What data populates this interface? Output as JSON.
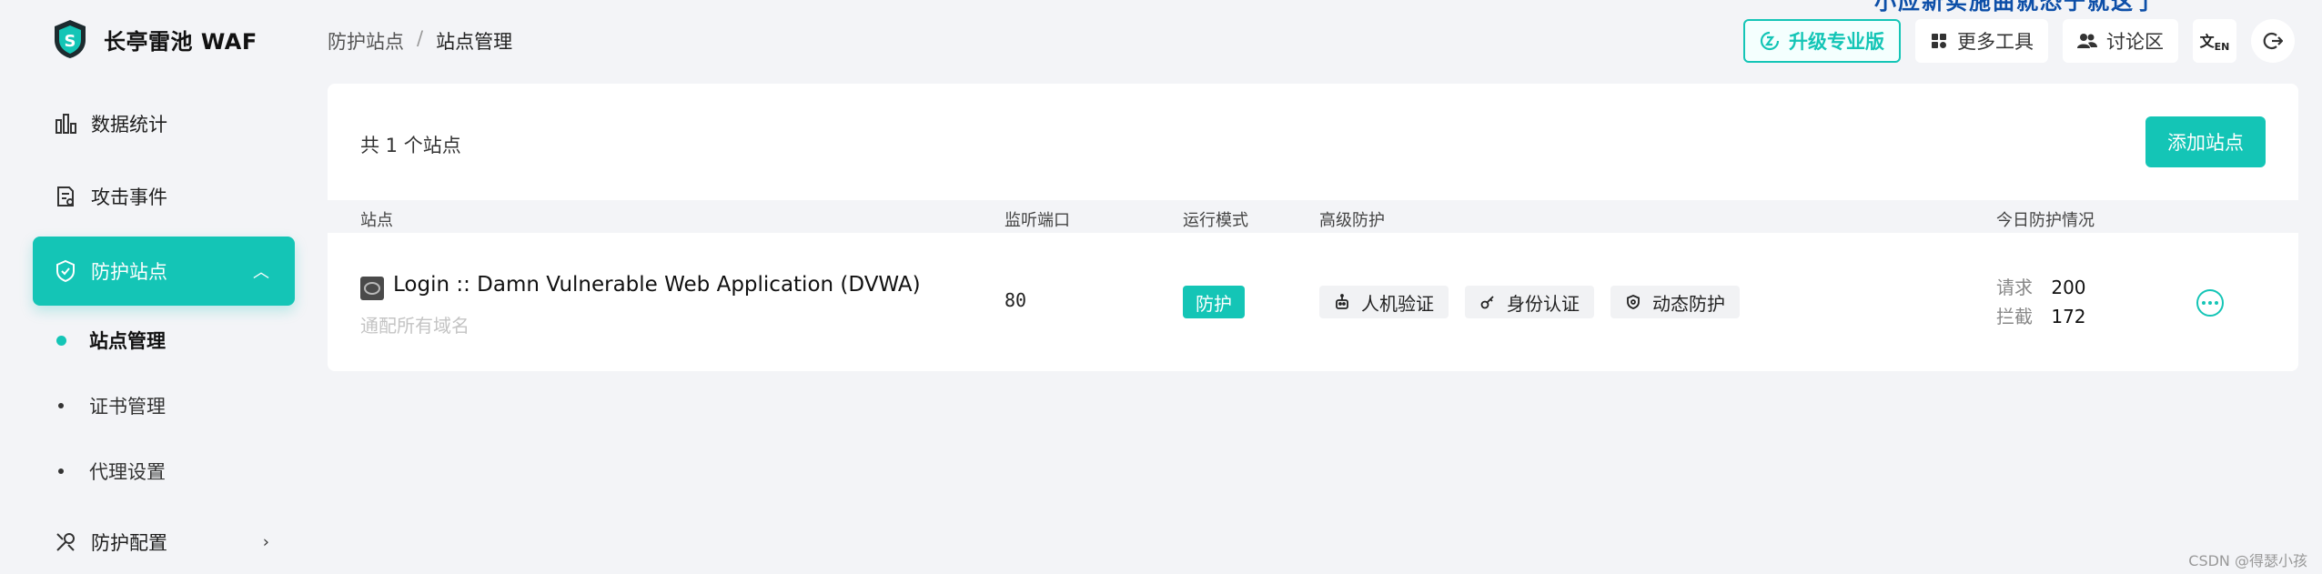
{
  "app": {
    "name": "长亭雷池 WAF"
  },
  "top_fragment": "小应新实施曲就恐于就这了",
  "sidebar": {
    "items": [
      {
        "label": "数据统计",
        "icon": "bar-chart-icon"
      },
      {
        "label": "攻击事件",
        "icon": "document-alert-icon"
      },
      {
        "label": "防护站点",
        "icon": "shield-icon",
        "active": true,
        "expanded": true
      },
      {
        "label": "防护配置",
        "icon": "tools-icon"
      }
    ],
    "sub_items": [
      {
        "label": "站点管理",
        "active": true
      },
      {
        "label": "证书管理"
      },
      {
        "label": "代理设置"
      }
    ]
  },
  "breadcrumb": {
    "parent": "防护站点",
    "separator": "/",
    "current": "站点管理"
  },
  "topbar": {
    "upgrade_label": "升级专业版",
    "tools_label": "更多工具",
    "forum_label": "讨论区",
    "lang_icon": "translate-icon",
    "logout_icon": "logout-icon"
  },
  "card": {
    "count_text": "共 1 个站点",
    "add_button": "添加站点",
    "columns": {
      "site": "站点",
      "port": "监听端口",
      "mode": "运行模式",
      "advanced": "高级防护",
      "today": "今日防护情况"
    },
    "rows": [
      {
        "site_name": "Login :: Damn Vulnerable Web Application (DVWA)",
        "domain": "通配所有域名",
        "port": "80",
        "mode": "防护",
        "tags": [
          "人机验证",
          "身份认证",
          "动态防护"
        ],
        "stats": {
          "request_label": "请求",
          "request_value": "200",
          "block_label": "拦截",
          "block_value": "172"
        }
      }
    ]
  },
  "watermark": "CSDN @得瑟小孩",
  "colors": {
    "accent": "#14c5b6",
    "background": "#f3f4f7"
  }
}
